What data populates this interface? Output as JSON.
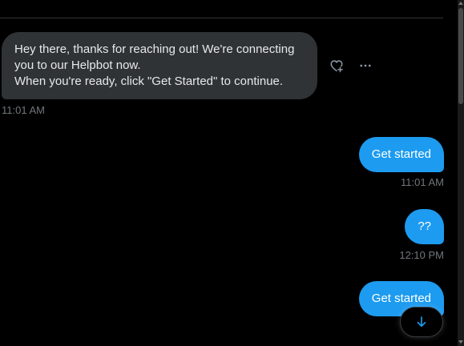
{
  "incoming_message": {
    "lines": [
      "Hey there, thanks for reaching out! We're connecting",
      "you to our Helpbot now.",
      "When you're ready, click \"Get Started\" to continue."
    ],
    "time": "11:01 AM",
    "actions": [
      {
        "icon": "add-reaction-icon"
      },
      {
        "icon": "more-icon"
      }
    ]
  },
  "outgoing_messages": [
    {
      "text": "Get started",
      "time": "11:01 AM"
    },
    {
      "text": "??",
      "time": "12:10 PM"
    },
    {
      "text": "Get started"
    }
  ],
  "scroll_button": {
    "icon": "arrow-down-icon"
  },
  "colors": {
    "background": "#000000",
    "incoming_bubble": "#2f3336",
    "outgoing_bubble": "#1d9bf0",
    "timestamp": "#71767b",
    "accent": "#1d9bf0"
  }
}
